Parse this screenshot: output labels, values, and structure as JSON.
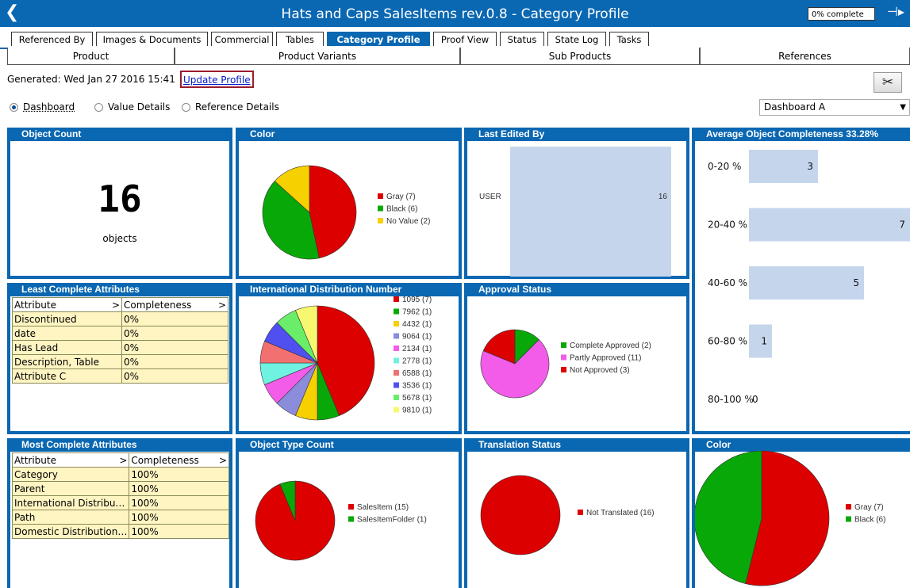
{
  "window": {
    "title": "Hats and Caps SalesItems rev.0.8 - Category Profile",
    "progress_text": "0% complete",
    "back_glyph": "❮",
    "pin_glyph": "⊣▸"
  },
  "tabs": [
    "Referenced By",
    "Images & Documents",
    "Commercial",
    "Tables",
    "Category Profile",
    "Proof View",
    "Status",
    "State Log",
    "Tasks"
  ],
  "active_tab": "Category Profile",
  "subtabs": [
    "Product",
    "Product Variants",
    "Sub Products",
    "References"
  ],
  "toolbar": {
    "generated": "Generated: Wed Jan 27 2016 15:41",
    "update_link": "Update Profile",
    "tool_glyph": "✂"
  },
  "view_options": {
    "radios": [
      "Dashboard",
      "Value Details",
      "Reference Details"
    ],
    "selected": "Dashboard",
    "dashboard_select": "Dashboard A"
  },
  "panels": {
    "object_count": {
      "title": "Object Count",
      "count": "16",
      "unit": "objects"
    },
    "color_top": {
      "title": "Color"
    },
    "last_edited": {
      "title": "Last Edited By"
    },
    "avg_completeness": {
      "title": "Average Object Completeness 33.28%"
    },
    "least_complete": {
      "title": "Least Complete Attributes",
      "headers": [
        "Attribute",
        "Completeness"
      ],
      "sort_glyph": ">",
      "rows": [
        [
          "Discontinued",
          "0%"
        ],
        [
          "date",
          "0%"
        ],
        [
          "Has Lead",
          "0%"
        ],
        [
          "Description, Table",
          "0%"
        ],
        [
          "Attribute C",
          "0%"
        ]
      ]
    },
    "intl_distribution": {
      "title": "International Distribution Number"
    },
    "approval_status": {
      "title": "Approval Status"
    },
    "most_complete": {
      "title": "Most Complete Attributes",
      "headers": [
        "Attribute",
        "Completeness"
      ],
      "sort_glyph": ">",
      "rows": [
        [
          "Category",
          "100%"
        ],
        [
          "Parent",
          "100%"
        ],
        [
          "International Distribu…",
          "100%"
        ],
        [
          "Path",
          "100%"
        ],
        [
          "Domestic Distribution…",
          "100%"
        ]
      ]
    },
    "object_type_count": {
      "title": "Object Type Count"
    },
    "translation_status": {
      "title": "Translation Status"
    },
    "color_bottom": {
      "title": "Color"
    }
  },
  "chart_data": [
    {
      "id": "color_top",
      "type": "pie",
      "labels": [
        "Gray (7)",
        "Black (6)",
        "No Value (2)"
      ],
      "values": [
        7,
        6,
        2
      ],
      "colors": [
        "#dd0000",
        "#08a808",
        "#f7d000"
      ]
    },
    {
      "id": "last_edited",
      "type": "bar",
      "categories": [
        "USER"
      ],
      "values": [
        16
      ],
      "colors": [
        "#c5d6ec"
      ]
    },
    {
      "id": "avg_completeness",
      "type": "bar",
      "categories": [
        "0-20 %",
        "20-40 %",
        "40-60 %",
        "60-80 %",
        "80-100 %"
      ],
      "values": [
        3,
        7,
        5,
        1,
        0
      ],
      "colors": [
        "#c5d6ec"
      ]
    },
    {
      "id": "intl_distribution",
      "type": "pie",
      "labels": [
        "1095 (7)",
        "7962 (1)",
        "4432 (1)",
        "9064 (1)",
        "2134 (1)",
        "2778 (1)",
        "6588 (1)",
        "3536 (1)",
        "5678 (1)",
        "9810 (1)"
      ],
      "values": [
        7,
        1,
        1,
        1,
        1,
        1,
        1,
        1,
        1,
        1
      ],
      "colors": [
        "#dd0000",
        "#08a808",
        "#f7d000",
        "#8c8cdc",
        "#f25ce8",
        "#70f2e0",
        "#f27070",
        "#5050f0",
        "#6aee6a",
        "#f8f870"
      ]
    },
    {
      "id": "approval_status",
      "type": "pie",
      "labels": [
        "Complete Approved (2)",
        "Partly Approved (11)",
        "Not Approved (3)"
      ],
      "values": [
        2,
        11,
        3
      ],
      "colors": [
        "#08a808",
        "#f25ce8",
        "#dd0000"
      ]
    },
    {
      "id": "object_type_count",
      "type": "pie",
      "labels": [
        "SalesItem (15)",
        "SalesItemFolder (1)"
      ],
      "values": [
        15,
        1
      ],
      "colors": [
        "#dd0000",
        "#08a808"
      ]
    },
    {
      "id": "translation_status",
      "type": "pie",
      "labels": [
        "Not Translated (16)"
      ],
      "values": [
        16
      ],
      "colors": [
        "#dd0000"
      ]
    },
    {
      "id": "color_bottom",
      "type": "pie",
      "labels": [
        "Gray (7)",
        "Black (6)"
      ],
      "values": [
        7,
        6
      ],
      "colors": [
        "#dd0000",
        "#08a808"
      ]
    }
  ]
}
